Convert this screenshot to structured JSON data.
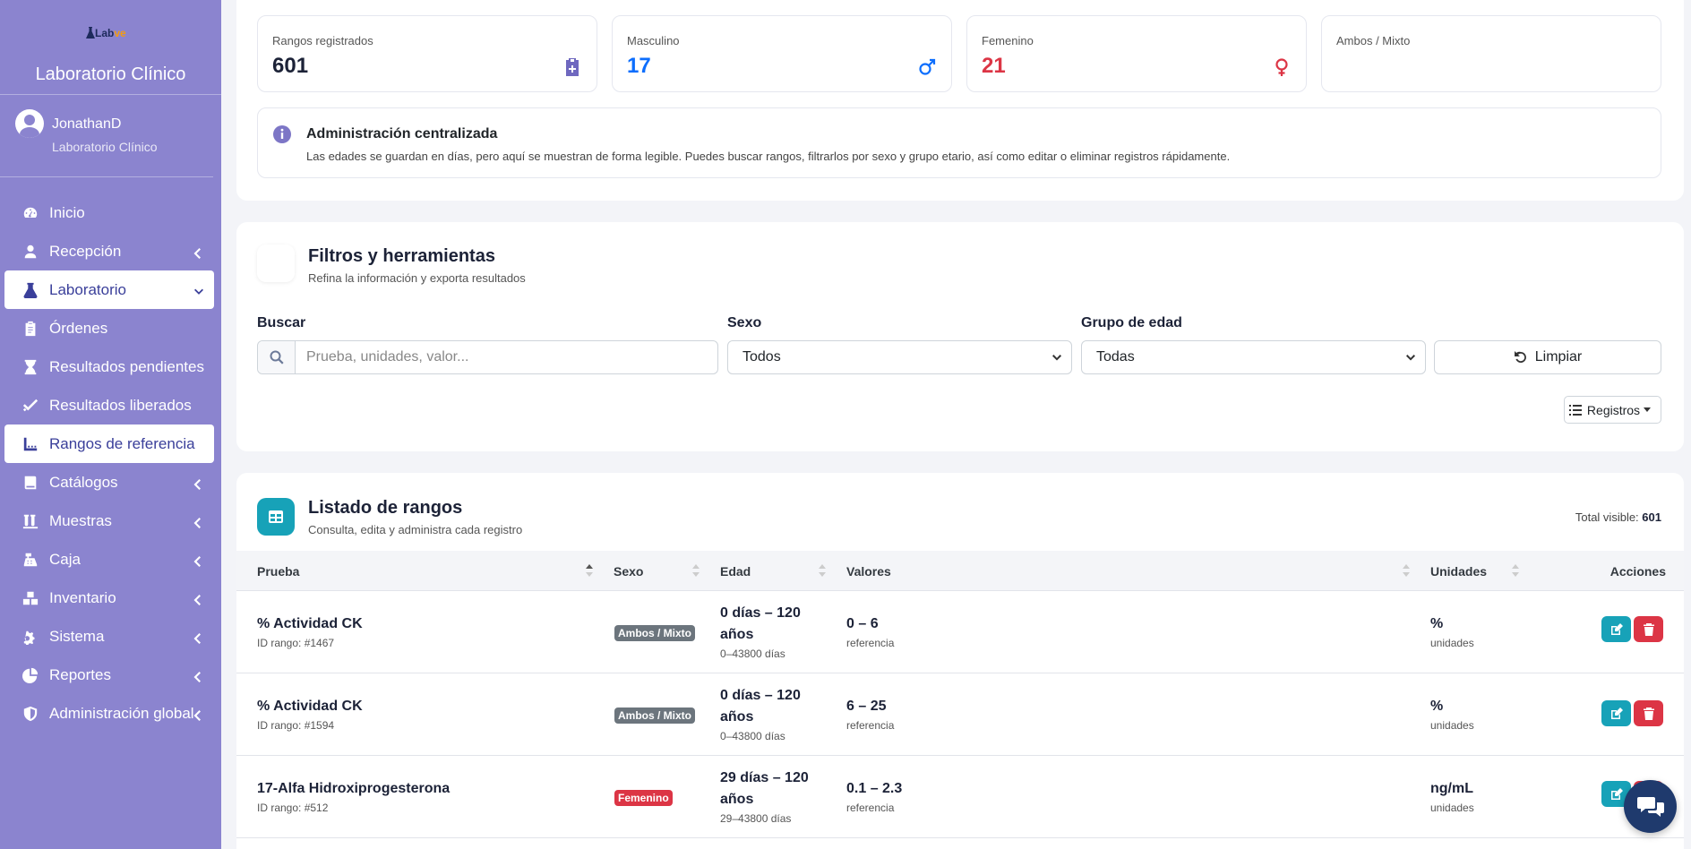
{
  "brand": {
    "logo_lab": "Lab",
    "logo_suffix": "ve",
    "title": "Laboratorio Clínico"
  },
  "user": {
    "name": "JonathanD",
    "role": "Laboratorio Clínico"
  },
  "nav": [
    {
      "label": "Inicio",
      "icon": "gauge-icon",
      "chevron": false
    },
    {
      "label": "Recepción",
      "icon": "user-nurse-icon",
      "chevron": true
    },
    {
      "label": "Laboratorio",
      "icon": "flask-icon",
      "chevron": true,
      "active": true
    },
    {
      "label": "Órdenes",
      "icon": "clipboard-icon",
      "chevron": false
    },
    {
      "label": "Resultados pendientes",
      "icon": "hourglass-icon",
      "chevron": false
    },
    {
      "label": "Resultados liberados",
      "icon": "double-check-icon",
      "chevron": false
    },
    {
      "label": "Rangos de referencia",
      "icon": "ruler-icon",
      "chevron": false,
      "active": true
    },
    {
      "label": "Catálogos",
      "icon": "book-icon",
      "chevron": true
    },
    {
      "label": "Muestras",
      "icon": "vials-icon",
      "chevron": true
    },
    {
      "label": "Caja",
      "icon": "cash-register-icon",
      "chevron": true
    },
    {
      "label": "Inventario",
      "icon": "boxes-icon",
      "chevron": true
    },
    {
      "label": "Sistema",
      "icon": "gears-icon",
      "chevron": true
    },
    {
      "label": "Reportes",
      "icon": "pie-chart-icon",
      "chevron": true
    },
    {
      "label": "Administración global",
      "icon": "shield-icon",
      "chevron": true
    }
  ],
  "stats": {
    "total": {
      "label": "Rangos registrados",
      "value": "601"
    },
    "male": {
      "label": "Masculino",
      "value": "17"
    },
    "female": {
      "label": "Femenino",
      "value": "21"
    },
    "mixed": {
      "label": "Ambos / Mixto",
      "value": ""
    }
  },
  "info": {
    "title": "Administración centralizada",
    "desc": "Las edades se guardan en días, pero aquí se muestran de forma legible. Puedes buscar rangos, filtrarlos por sexo y grupo etario, así como editar o eliminar registros rápidamente."
  },
  "filters": {
    "title": "Filtros y herramientas",
    "subtitle": "Refina la información y exporta resultados",
    "search_label": "Buscar",
    "search_placeholder": "Prueba, unidades, valor...",
    "sex_label": "Sexo",
    "sex_value": "Todos",
    "age_label": "Grupo de edad",
    "age_value": "Todas",
    "clear_label": "Limpiar",
    "records_label": "Registros"
  },
  "list": {
    "title": "Listado de rangos",
    "subtitle": "Consulta, edita y administra cada registro",
    "total_label": "Total visible:",
    "total_value": "601",
    "headers": {
      "test": "Prueba",
      "sex": "Sexo",
      "age": "Edad",
      "values": "Valores",
      "units": "Unidades",
      "actions": "Acciones"
    },
    "rows": [
      {
        "test": "% Actividad CK",
        "id": "ID rango: #1467",
        "sex": "Ambos / Mixto",
        "sex_color": "#6c757d",
        "age1": "0 días – 120",
        "age2": "años",
        "age_days": "0–43800 días",
        "values": "0 – 6",
        "values_sub": "referencia",
        "units": "%",
        "units_sub": "unidades"
      },
      {
        "test": "% Actividad CK",
        "id": "ID rango: #1594",
        "sex": "Ambos / Mixto",
        "sex_color": "#6c757d",
        "age1": "0 días – 120",
        "age2": "años",
        "age_days": "0–43800 días",
        "values": "6 – 25",
        "values_sub": "referencia",
        "units": "%",
        "units_sub": "unidades"
      },
      {
        "test": "17-Alfa Hidroxiprogesterona",
        "id": "ID rango: #512",
        "sex": "Femenino",
        "sex_color": "#dc3545",
        "age1": "29 días – 120",
        "age2": "años",
        "age_days": "29–43800 días",
        "values": "0.1 – 2.3",
        "values_sub": "referencia",
        "units": "ng/mL",
        "units_sub": "unidades"
      }
    ]
  },
  "colors": {
    "sidebar": "#8b84cf",
    "male": "#0d6efd",
    "female": "#dc3545",
    "teal": "#17a2b8",
    "danger": "#dc3545"
  }
}
